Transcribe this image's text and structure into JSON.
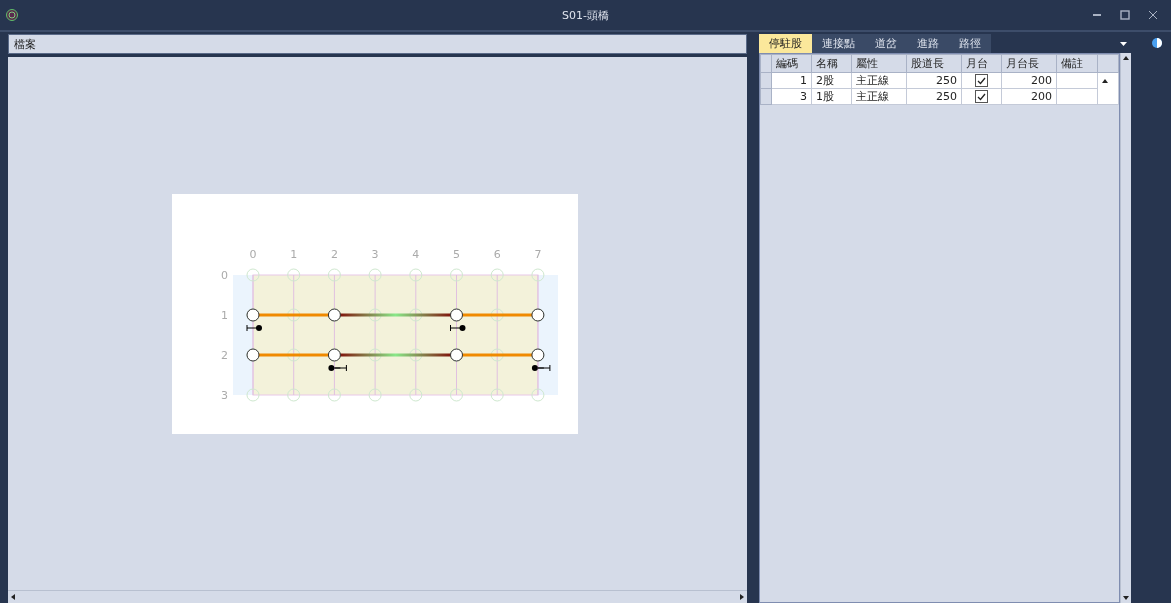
{
  "window": {
    "title": "S01-頭橋"
  },
  "left_panel": {
    "header": "檔案",
    "diagram": {
      "column_labels": [
        "0",
        "1",
        "2",
        "3",
        "4",
        "5",
        "6",
        "7"
      ],
      "row_labels": [
        "0",
        "1",
        "2",
        "3"
      ]
    }
  },
  "tabs": [
    {
      "label": "停駐股",
      "selected": true
    },
    {
      "label": "連接點",
      "selected": false
    },
    {
      "label": "道岔",
      "selected": false
    },
    {
      "label": "進路",
      "selected": false
    },
    {
      "label": "路徑",
      "selected": false
    }
  ],
  "table": {
    "columns": [
      "編碼",
      "名稱",
      "屬性",
      "股道長",
      "月台",
      "月台長",
      "備註"
    ],
    "rows": [
      {
        "code": "1",
        "name": "2股",
        "type": "主正線",
        "length": "250",
        "platform": true,
        "platform_length": "200",
        "note": ""
      },
      {
        "code": "3",
        "name": "1股",
        "type": "主正線",
        "length": "250",
        "platform": true,
        "platform_length": "200",
        "note": ""
      }
    ]
  }
}
